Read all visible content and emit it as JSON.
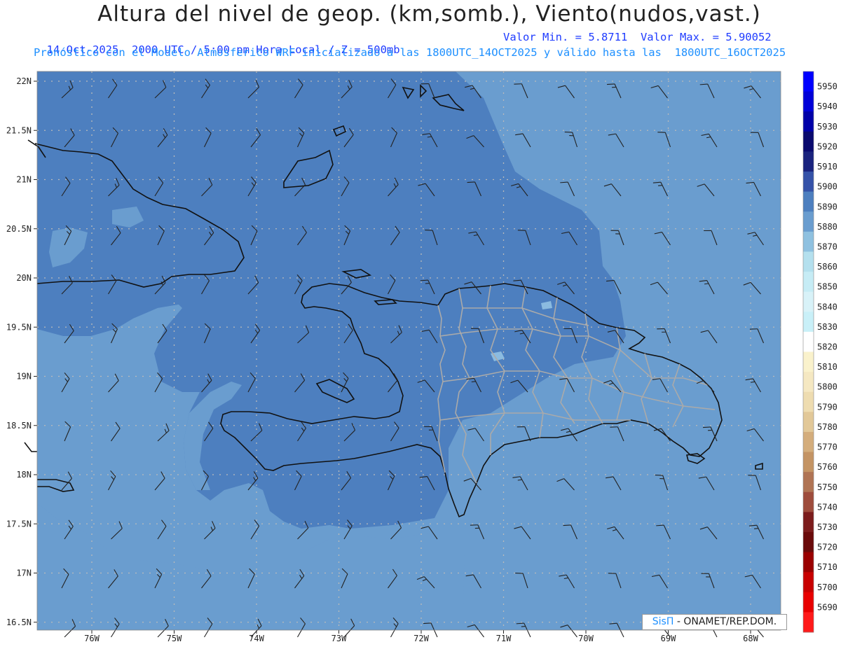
{
  "header": {
    "title": "Altura del nivel de geop. (km,somb.), Viento(nudos,vast.)",
    "date_line": "14-Oct-2025  2000 UTC / 5:00 pm Hora Local / Z = 500mb",
    "minmax_line": "Valor Min. = 5.8711  Valor Max. = 5.90052",
    "model_line": "Pronóstico con el Modelo Atmosferico WRF inicializado a las 1800UTC_14OCT2025 y válido hasta las  1800UTC_16OCT2025"
  },
  "map": {
    "lat_labels": [
      "22N",
      "21.5N",
      "21N",
      "20.5N",
      "20N",
      "19.5N",
      "19N",
      "18.5N",
      "18N",
      "17.5N",
      "17N",
      "16.5N"
    ],
    "lon_labels": [
      "76W",
      "75W",
      "74W",
      "73W",
      "72W",
      "71W",
      "70W",
      "69W",
      "68W"
    ],
    "lat_values": [
      22,
      21.5,
      21,
      20.5,
      20,
      19.5,
      19,
      18.5,
      18,
      17.5,
      17,
      16.5
    ],
    "lon_values": [
      -76,
      -75,
      -74,
      -73,
      -72,
      -71,
      -70,
      -69,
      -68
    ],
    "shade_colors": {
      "level_5890": "#4d7fbf",
      "level_5880": "#6a9dcf",
      "level_5870": "#8bbbe0",
      "land_outline": "#111111",
      "provinces": "#aaaaaa",
      "wind_barbs": "#222222",
      "grid": "#bbbbbb"
    }
  },
  "colorbar": {
    "levels": [
      "5950",
      "5940",
      "5930",
      "5920",
      "5910",
      "5900",
      "5890",
      "5880",
      "5870",
      "5860",
      "5850",
      "5840",
      "5830",
      "5820",
      "5810",
      "5800",
      "5790",
      "5780",
      "5770",
      "5760",
      "5750",
      "5740",
      "5730",
      "5720",
      "5710",
      "5700",
      "5690"
    ],
    "colors": [
      "#0000ff",
      "#0000d8",
      "#0000a8",
      "#0a0a6e",
      "#1a237e",
      "#3552a8",
      "#4d7fbf",
      "#6a9dcf",
      "#8fc1e0",
      "#b4e0ee",
      "#c6ecf5",
      "#d8f2f8",
      "#c9f0f8",
      "#ffffff",
      "#faf2cc",
      "#f5e8c2",
      "#eedcb0",
      "#e2c898",
      "#d4ad7c",
      "#c49464",
      "#b07454",
      "#9e4c3c",
      "#7c1c1c",
      "#6a0a0a",
      "#9a0000",
      "#c80000",
      "#e80000",
      "#ff1a1a"
    ]
  },
  "footer": {
    "brand": "SisΠ",
    "credit": " - ONAMET/REP.DOM."
  }
}
